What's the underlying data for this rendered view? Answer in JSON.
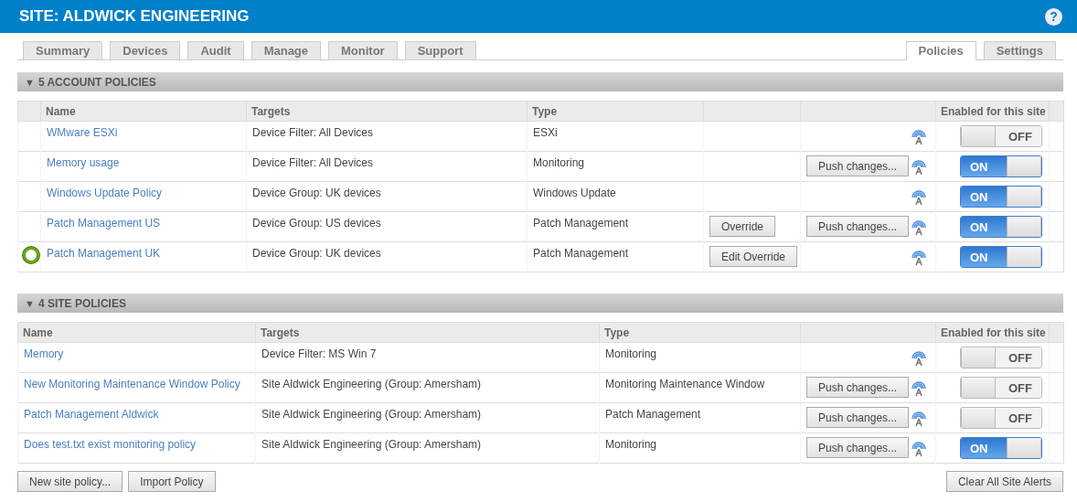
{
  "header": {
    "title": "SITE: ALDWICK ENGINEERING"
  },
  "tabs_left": [
    {
      "label": "Summary",
      "selected": false
    },
    {
      "label": "Devices",
      "selected": false
    },
    {
      "label": "Audit",
      "selected": false
    },
    {
      "label": "Manage",
      "selected": false
    },
    {
      "label": "Monitor",
      "selected": false
    },
    {
      "label": "Support",
      "selected": false
    }
  ],
  "tabs_right": [
    {
      "label": "Policies",
      "selected": true
    },
    {
      "label": "Settings",
      "selected": false
    }
  ],
  "account_policies": {
    "title": "5 ACCOUNT POLICIES",
    "expanded": true,
    "columns": [
      "Name",
      "Targets",
      "Type",
      "Enabled for this site"
    ],
    "rows": [
      {
        "status": false,
        "name": "WMware ESXi",
        "targets": "Device Filter: All Devices",
        "type": "ESXi",
        "on": false,
        "toggle_label": "OFF"
      },
      {
        "status": false,
        "name": "Memory usage",
        "targets": "Device Filter: All Devices",
        "type": "Monitoring",
        "push": "Push changes...",
        "on": true,
        "toggle_label": "ON"
      },
      {
        "status": false,
        "name": "Windows Update Policy",
        "targets": "Device Group: UK devices",
        "type": "Windows Update",
        "on": true,
        "toggle_label": "ON"
      },
      {
        "status": false,
        "name": "Patch Management US",
        "targets": "Device Group: US devices",
        "type": "Patch Management",
        "override": "Override",
        "push": "Push changes...",
        "on": true,
        "toggle_label": "ON"
      },
      {
        "status": true,
        "name": "Patch Management UK",
        "targets": "Device Group: UK devices",
        "type": "Patch Management",
        "override": "Edit Override",
        "on": true,
        "toggle_label": "ON"
      }
    ]
  },
  "site_policies": {
    "title": "4 SITE POLICIES",
    "expanded": true,
    "columns": [
      "Name",
      "Targets",
      "Type",
      "Enabled for this site"
    ],
    "rows": [
      {
        "name": "Memory",
        "targets": "Device Filter: MS Win 7",
        "type": "Monitoring",
        "on": false,
        "toggle_label": "OFF"
      },
      {
        "name": "New Monitoring Maintenance Window Policy",
        "targets": "Site Aldwick Engineering (Group: Amersham)",
        "type": "Monitoring Maintenance Window",
        "push": "Push changes...",
        "on": false,
        "toggle_label": "OFF"
      },
      {
        "name": "Patch Management Aldwick",
        "targets": "Site Aldwick Engineering (Group: Amersham)",
        "type": "Patch Management",
        "push": "Push changes...",
        "on": false,
        "toggle_label": "OFF"
      },
      {
        "name": "Does test.txt exist monitoring policy",
        "targets": "Site Aldwick Engineering (Group: Amersham)",
        "type": "Monitoring",
        "push": "Push changes...",
        "on": true,
        "toggle_label": "ON"
      }
    ]
  },
  "footer_buttons_left": [
    "New site policy...",
    "Import Policy"
  ],
  "footer_button_right": "Clear All Site Alerts",
  "help": "?",
  "collapse_glyph": "▼"
}
